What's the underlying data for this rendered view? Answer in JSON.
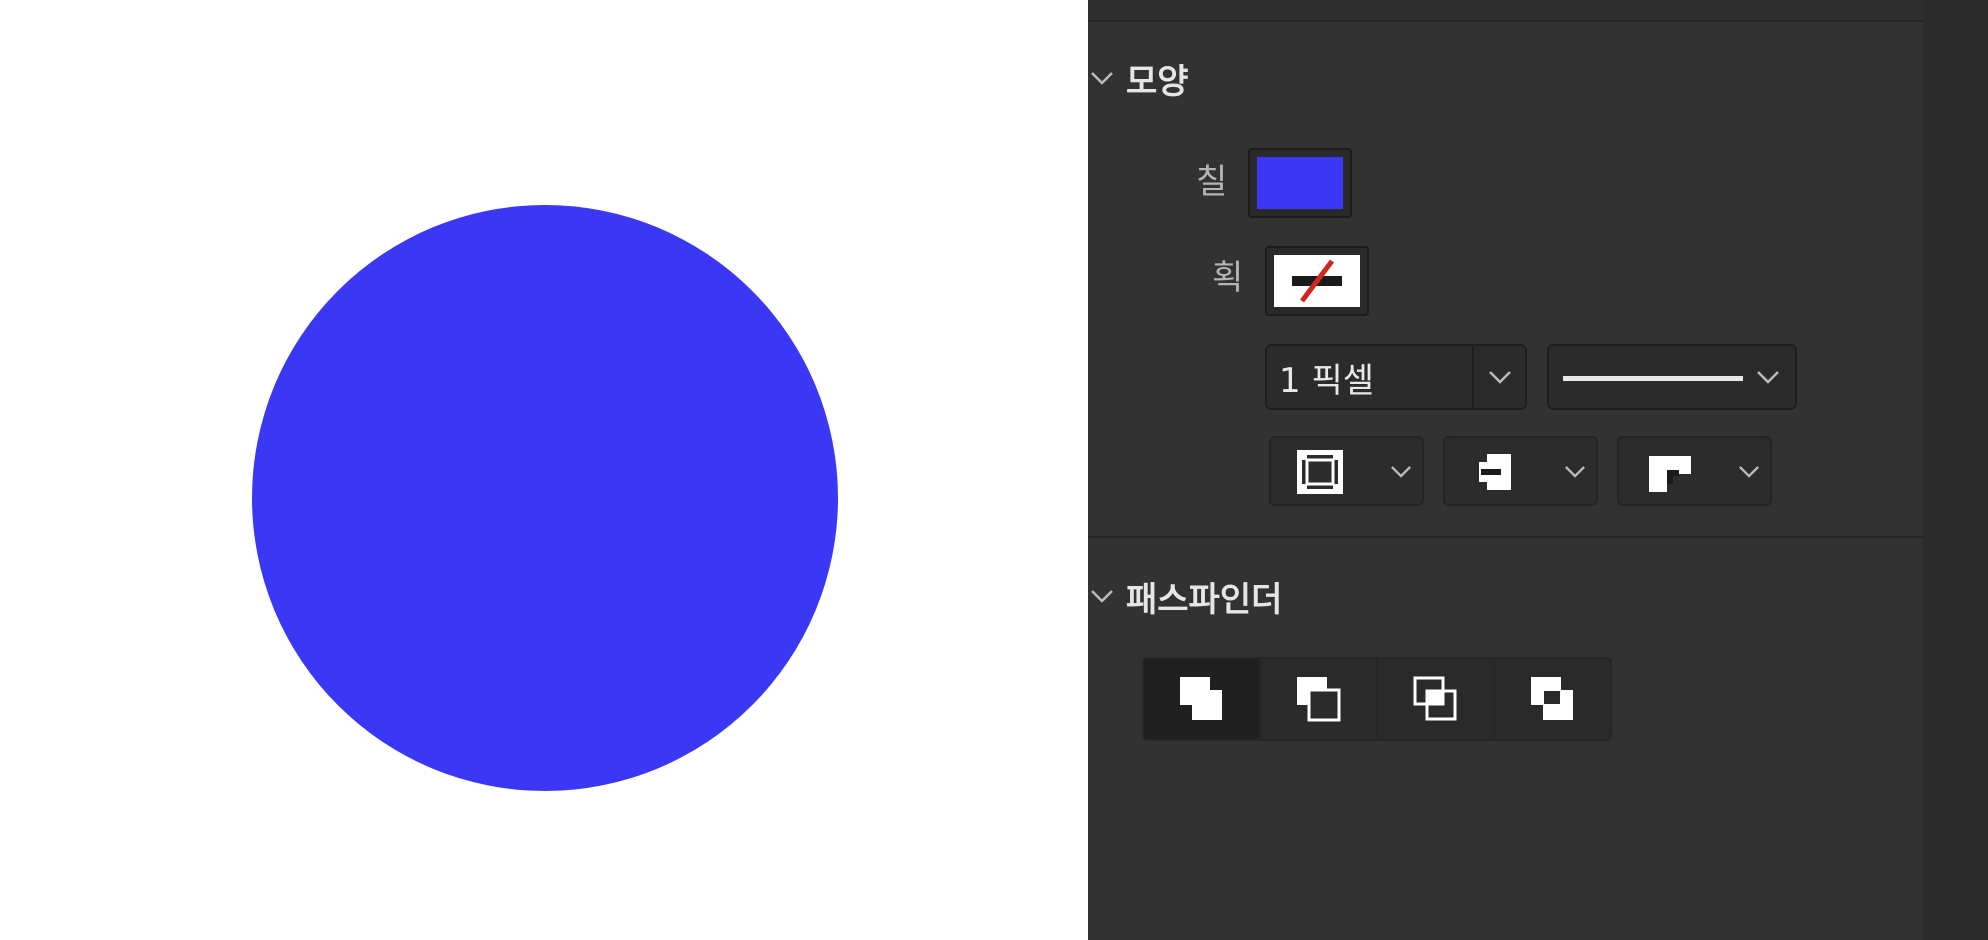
{
  "canvas": {
    "shape_fill": "#3a37f5"
  },
  "panel": {
    "background": "#323232",
    "appearance": {
      "title": "모양",
      "fill_label": "칠",
      "fill_color": "#3a37f5",
      "stroke_label": "획",
      "stroke_color": "none",
      "stroke_width_value": "1 픽셀",
      "stroke_style": "solid-line",
      "align_stroke_icon": "align-stroke-inside-icon",
      "cap_icon": "stroke-cap-icon",
      "corner_icon": "stroke-corner-icon"
    },
    "pathfinder": {
      "title": "패스파인더",
      "buttons": [
        {
          "icon": "pathfinder-unite-icon",
          "active": true
        },
        {
          "icon": "pathfinder-minus-front-icon",
          "active": false
        },
        {
          "icon": "pathfinder-intersect-icon",
          "active": false
        },
        {
          "icon": "pathfinder-exclude-icon",
          "active": false
        }
      ]
    }
  }
}
